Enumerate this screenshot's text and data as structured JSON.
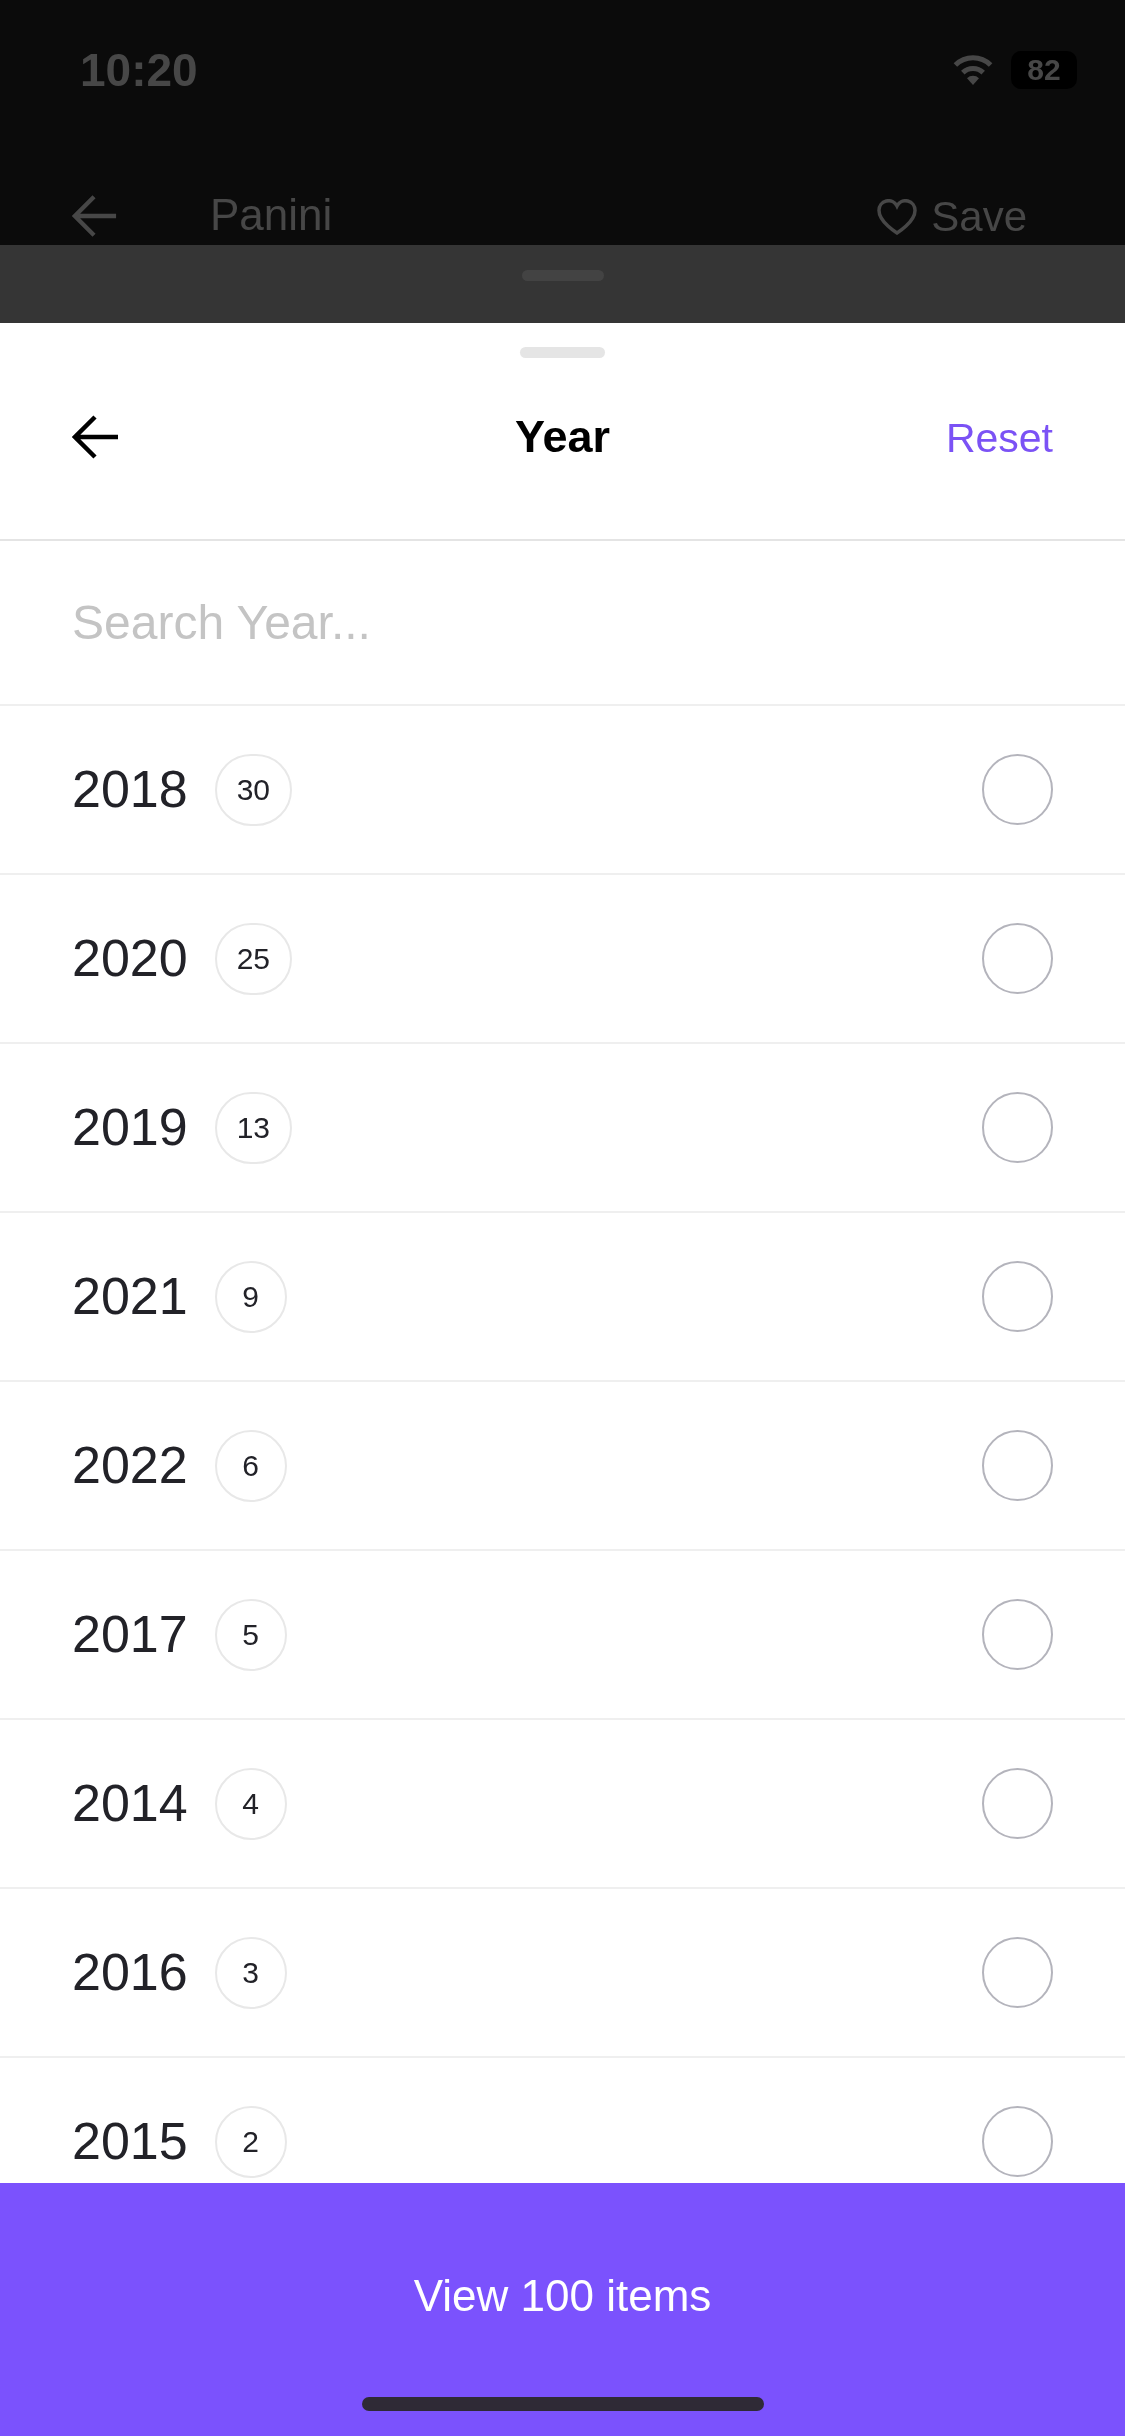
{
  "status_bar": {
    "time": "10:20",
    "battery": "82"
  },
  "background_page": {
    "title": "Panini",
    "save_label": "Save"
  },
  "sheet": {
    "title": "Year",
    "reset_label": "Reset",
    "search": {
      "placeholder": "Search Year..."
    }
  },
  "options": [
    {
      "year": "2018",
      "count": "30",
      "selected": false
    },
    {
      "year": "2020",
      "count": "25",
      "selected": false
    },
    {
      "year": "2019",
      "count": "13",
      "selected": false
    },
    {
      "year": "2021",
      "count": "9",
      "selected": false
    },
    {
      "year": "2022",
      "count": "6",
      "selected": false
    },
    {
      "year": "2017",
      "count": "5",
      "selected": false
    },
    {
      "year": "2014",
      "count": "4",
      "selected": false
    },
    {
      "year": "2016",
      "count": "3",
      "selected": false
    },
    {
      "year": "2015",
      "count": "2",
      "selected": false
    }
  ],
  "apply_button": {
    "label": "View 100 items"
  }
}
